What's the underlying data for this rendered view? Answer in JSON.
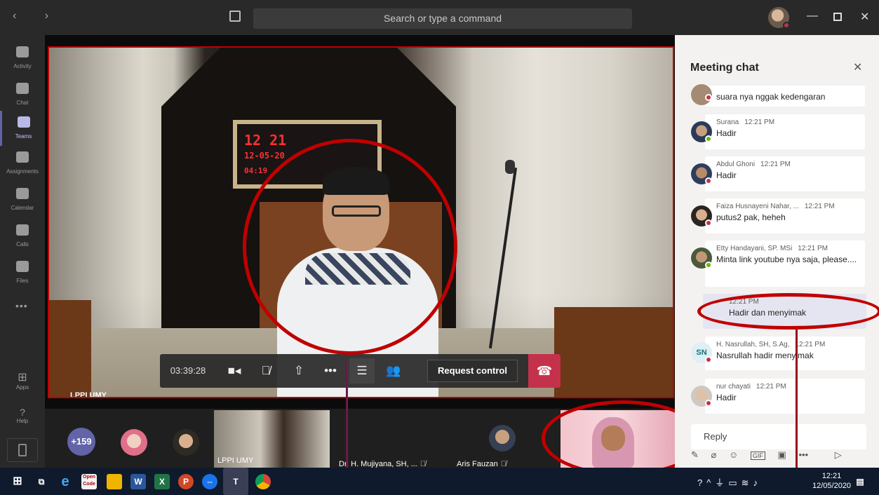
{
  "titlebar": {
    "search_placeholder": "Search or type a command"
  },
  "rail": {
    "items": [
      {
        "label": "Activity"
      },
      {
        "label": "Chat"
      },
      {
        "label": "Teams"
      },
      {
        "label": "Assignments"
      },
      {
        "label": "Calendar"
      },
      {
        "label": "Calls"
      },
      {
        "label": "Files"
      }
    ],
    "more": "•••",
    "apps": "Apps",
    "help": "Help"
  },
  "video": {
    "name_label": "LPPI UMY",
    "clock_digits": [
      "12 21",
      "12-05-20",
      "04:19"
    ]
  },
  "controls": {
    "timer": "03:39:28",
    "request_control": "Request control"
  },
  "strip": {
    "more_count": "+159",
    "thumbs": [
      {
        "label": "LPPI UMY"
      },
      {
        "label": "Dr. H. Mujiyana, SH, ..."
      },
      {
        "label": "Aris Fauzan"
      }
    ]
  },
  "chat": {
    "title": "Meeting chat",
    "messages": [
      {
        "name": "",
        "time": "",
        "text": "suara nya nggak kedengaran",
        "status": "busy"
      },
      {
        "name": "Surana",
        "time": "12:21 PM",
        "text": "Hadir",
        "status": "ok"
      },
      {
        "name": "Abdul Ghoni",
        "time": "12:21 PM",
        "text": "Hadir",
        "status": "busy"
      },
      {
        "name": "Faiza Husnayeni Nahar, ...",
        "time": "12:21 PM",
        "text": "putus2 pak, heheh",
        "status": "busy"
      },
      {
        "name": "Etty Handayani, SP. MSi",
        "time": "12:21 PM",
        "text": "Minta link youtube nya saja, please....",
        "status": "ok"
      },
      {
        "name": "H. Nasrullah, SH, S.Ag,",
        "time": "12:21 PM",
        "text": "Nasrullah hadir menyimak",
        "status": "busy",
        "initials": "SN"
      },
      {
        "name": "nur chayati",
        "time": "12:21 PM",
        "text": "Hadir",
        "status": "busy"
      }
    ],
    "self_message": {
      "time": "12:21 PM",
      "text": "Hadir dan menyimak"
    },
    "reply_placeholder": "Reply"
  },
  "taskbar": {
    "time": "12:21",
    "date": "12/05/2020"
  },
  "colors": {
    "accent": "#6264a7",
    "hangup": "#c4314b",
    "annotation": "#c00000",
    "busy": "#c4314b",
    "available": "#6bb700"
  }
}
